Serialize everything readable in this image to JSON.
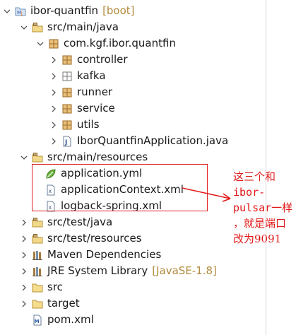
{
  "tree": {
    "project": {
      "label": "ibor-quantfin",
      "decoration": "[boot]"
    },
    "src_main_java": "src/main/java",
    "package": "com.kgf.ibor.quantfin",
    "packages": [
      "controller",
      "kafka",
      "runner",
      "service",
      "utils"
    ],
    "main_class": "IborQuantfinApplication.java",
    "src_main_resources": "src/main/resources",
    "resources": [
      "application.yml",
      "applicationContext.xml",
      "logback-spring.xml"
    ],
    "src_test_java": "src/test/java",
    "src_test_resources": "src/test/resources",
    "maven_deps": "Maven Dependencies",
    "jre": {
      "label": "JRE System Library",
      "decoration": "[JavaSE-1.8]"
    },
    "src": "src",
    "target": "target",
    "pom": "pom.xml"
  },
  "annotation": {
    "lines": [
      "这三个和",
      "ibor-",
      "pulsar一样",
      "，就是端口",
      "改为9091"
    ]
  },
  "colors": {
    "annotation": "#e11919",
    "decoration": "#b18a3b"
  }
}
